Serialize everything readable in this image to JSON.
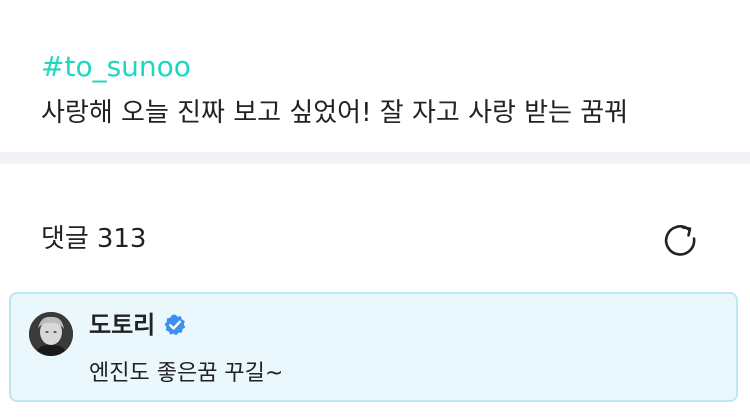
{
  "post": {
    "hashtag": "#to_sunoo",
    "body": "사랑해 오늘 진짜 보고 싶었어! 잘 자고 사랑 받는 꿈꿔"
  },
  "comments": {
    "label": "댓글",
    "count": "313",
    "refresh_icon": "refresh-icon"
  },
  "comment": {
    "author": "도토리",
    "verified_icon": "verified-badge-icon",
    "text": "엔진도 좋은꿈 꾸길~"
  },
  "colors": {
    "hashtag": "#1fd6c0",
    "verified": "#3d8ff0",
    "comment_bg": "#eaf8fd",
    "comment_border": "#bfe7f3",
    "divider": "#f1f3f6"
  }
}
